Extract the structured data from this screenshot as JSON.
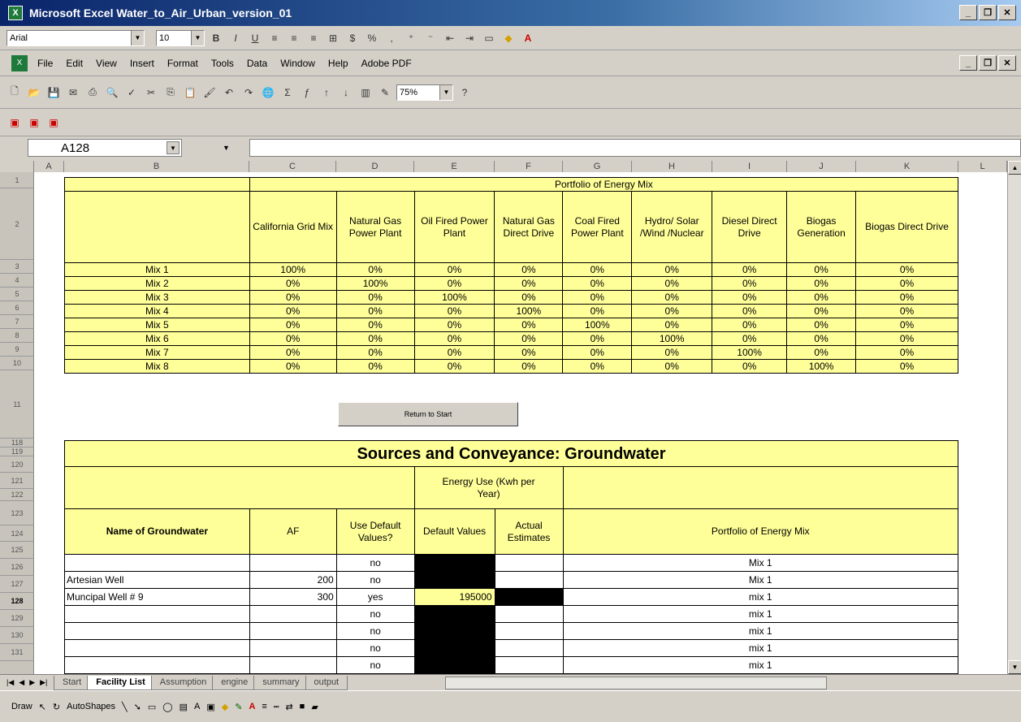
{
  "window": {
    "title": "Microsoft Excel  Water_to_Air_Urban_version_01"
  },
  "format_toolbar": {
    "font": "Arial",
    "size": "10"
  },
  "menu": [
    "File",
    "Edit",
    "View",
    "Insert",
    "Format",
    "Tools",
    "Data",
    "Window",
    "Help",
    "Adobe PDF"
  ],
  "standard_toolbar": {
    "zoom": "75%"
  },
  "name_box": "A128",
  "columns": [
    "A",
    "B",
    "C",
    "D",
    "E",
    "F",
    "G",
    "H",
    "I",
    "J",
    "K",
    "L"
  ],
  "row_headers": [
    "1",
    "2",
    "3",
    "4",
    "5",
    "6",
    "7",
    "8",
    "9",
    "10",
    "11",
    "118",
    "119",
    "120",
    "121",
    "122",
    "123",
    "124",
    "125",
    "126",
    "127",
    "128",
    "129",
    "130",
    "131"
  ],
  "mix_table": {
    "title": "Portfolio of Energy Mix",
    "headers": [
      "California Grid Mix",
      "Natural Gas Power Plant",
      "Oil Fired Power Plant",
      "Natural Gas Direct Drive",
      "Coal Fired Power Plant",
      "Hydro/ Solar /Wind /Nuclear",
      "Diesel Direct Drive",
      "Biogas Generation",
      "Biogas Direct Drive"
    ],
    "rows": [
      {
        "name": "Mix 1",
        "vals": [
          "100%",
          "0%",
          "0%",
          "0%",
          "0%",
          "0%",
          "0%",
          "0%",
          "0%"
        ]
      },
      {
        "name": "Mix 2",
        "vals": [
          "0%",
          "100%",
          "0%",
          "0%",
          "0%",
          "0%",
          "0%",
          "0%",
          "0%"
        ]
      },
      {
        "name": "Mix 3",
        "vals": [
          "0%",
          "0%",
          "100%",
          "0%",
          "0%",
          "0%",
          "0%",
          "0%",
          "0%"
        ]
      },
      {
        "name": "Mix 4",
        "vals": [
          "0%",
          "0%",
          "0%",
          "100%",
          "0%",
          "0%",
          "0%",
          "0%",
          "0%"
        ]
      },
      {
        "name": "Mix 5",
        "vals": [
          "0%",
          "0%",
          "0%",
          "0%",
          "100%",
          "0%",
          "0%",
          "0%",
          "0%"
        ]
      },
      {
        "name": "Mix 6",
        "vals": [
          "0%",
          "0%",
          "0%",
          "0%",
          "0%",
          "100%",
          "0%",
          "0%",
          "0%"
        ]
      },
      {
        "name": "Mix 7",
        "vals": [
          "0%",
          "0%",
          "0%",
          "0%",
          "0%",
          "0%",
          "100%",
          "0%",
          "0%"
        ]
      },
      {
        "name": "Mix 8",
        "vals": [
          "0%",
          "0%",
          "0%",
          "0%",
          "0%",
          "0%",
          "0%",
          "100%",
          "0%"
        ]
      }
    ]
  },
  "return_button": "Return to Start",
  "gw_table": {
    "title": "Sources and Conveyance: Groundwater",
    "energy_header": "Energy Use (Kwh per Year)",
    "headers": {
      "name": "Name of Groundwater",
      "af": "AF",
      "default_q": "Use Default Values?",
      "default": "Default Values",
      "actual": "Actual Estimates",
      "mix": "Portfolio of Energy Mix"
    },
    "rows": [
      {
        "n": "1",
        "name": "",
        "af": "",
        "use": "no",
        "def": "",
        "mix": "Mix 1"
      },
      {
        "n": "2",
        "name": "Artesian Well",
        "af": "200",
        "use": "no",
        "def": "",
        "mix": "Mix 1"
      },
      {
        "n": "3",
        "name": "Muncipal Well # 9",
        "af": "300",
        "use": "yes",
        "def": "195000",
        "mix": "mix 1"
      },
      {
        "n": "4",
        "name": "",
        "af": "",
        "use": "no",
        "def": "",
        "mix": "mix 1"
      },
      {
        "n": "5",
        "name": "",
        "af": "",
        "use": "no",
        "def": "",
        "mix": "mix 1"
      },
      {
        "n": "6",
        "name": "",
        "af": "",
        "use": "no",
        "def": "",
        "mix": "mix 1"
      },
      {
        "n": "7",
        "name": "",
        "af": "",
        "use": "no",
        "def": "",
        "mix": "mix 1"
      }
    ]
  },
  "sheet_tabs": [
    "Start",
    "Facility List",
    "Assumption",
    "engine",
    "summary",
    "output"
  ],
  "active_tab": "Facility List",
  "draw_toolbar": {
    "draw": "Draw",
    "autoshapes": "AutoShapes"
  }
}
